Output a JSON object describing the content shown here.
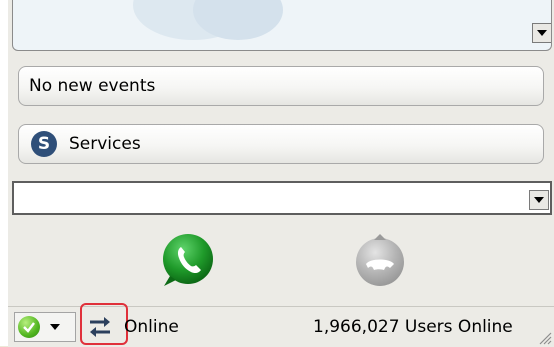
{
  "events": {
    "label": "No new events"
  },
  "services": {
    "label": "Services",
    "icon": "skype-logo-icon"
  },
  "number_field": {
    "value": ""
  },
  "calls": {
    "call_icon": "call-green-icon",
    "hangup_icon": "hangup-grey-icon",
    "call_color": "#1f9a2a",
    "hangup_color": "#b5b5b5"
  },
  "status_bar": {
    "status_text": "Online",
    "users_online": "1,966,027 Users Online",
    "status_icon": "online-status-icon",
    "sync_icon": "connection-arrows-icon",
    "highlight_color": "#e0303a"
  }
}
